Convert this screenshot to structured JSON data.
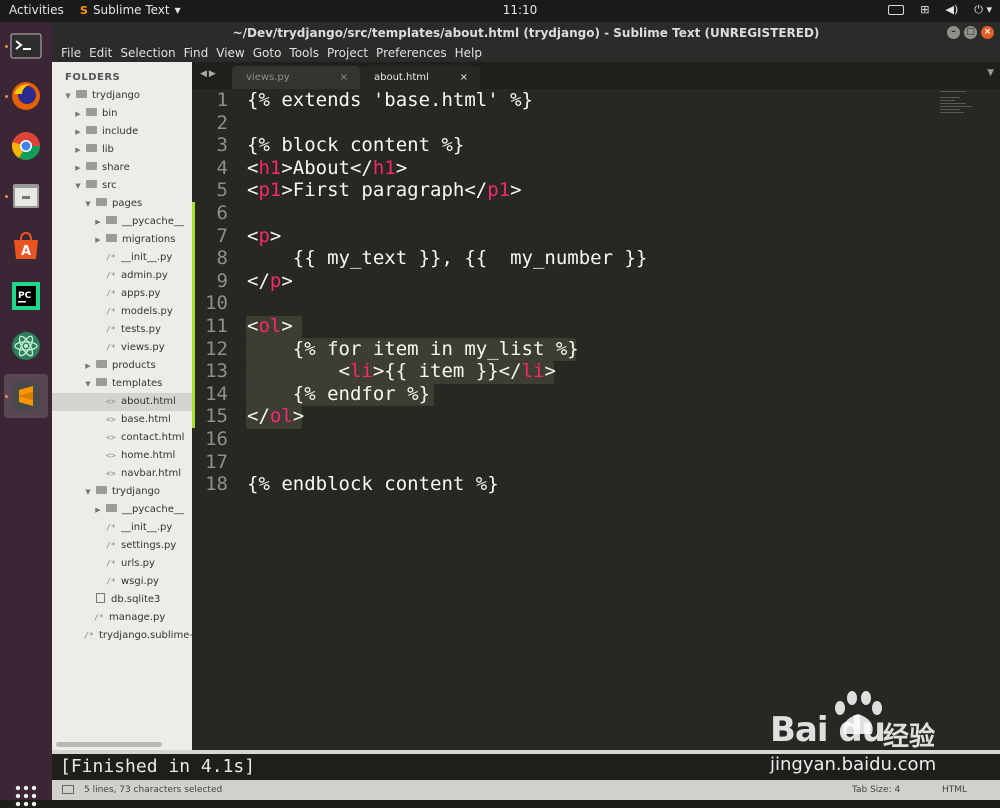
{
  "topbar": {
    "activities": "Activities",
    "app_name": "Sublime Text",
    "clock": "11:10"
  },
  "dock": {
    "items": [
      {
        "name": "terminal",
        "icon": "terminal-icon"
      },
      {
        "name": "firefox",
        "icon": "firefox-icon"
      },
      {
        "name": "chrome",
        "icon": "chrome-icon"
      },
      {
        "name": "files",
        "icon": "files-icon"
      },
      {
        "name": "software",
        "icon": "software-center-icon"
      },
      {
        "name": "pycharm",
        "icon": "pycharm-icon"
      },
      {
        "name": "atom",
        "icon": "atom-icon"
      },
      {
        "name": "sublime",
        "icon": "sublime-text-icon"
      }
    ]
  },
  "window": {
    "title": "~/Dev/trydjango/src/templates/about.html (trydjango) - Sublime Text (UNREGISTERED)"
  },
  "menu": [
    "File",
    "Edit",
    "Selection",
    "Find",
    "View",
    "Goto",
    "Tools",
    "Project",
    "Preferences",
    "Help"
  ],
  "sidebar": {
    "header": "FOLDERS",
    "items": [
      {
        "label": "trydjango",
        "type": "folder",
        "state": "open"
      },
      {
        "label": "bin",
        "type": "folder",
        "state": "closed"
      },
      {
        "label": "include",
        "type": "folder",
        "state": "closed"
      },
      {
        "label": "lib",
        "type": "folder",
        "state": "closed"
      },
      {
        "label": "share",
        "type": "folder",
        "state": "closed"
      },
      {
        "label": "src",
        "type": "folder",
        "state": "open"
      },
      {
        "label": "pages",
        "type": "folder",
        "state": "open"
      },
      {
        "label": "__pycache__",
        "type": "folder",
        "state": "closed"
      },
      {
        "label": "migrations",
        "type": "folder",
        "state": "closed"
      },
      {
        "label": "__init__.py",
        "type": "file",
        "glyph": "/*"
      },
      {
        "label": "admin.py",
        "type": "file",
        "glyph": "/*"
      },
      {
        "label": "apps.py",
        "type": "file",
        "glyph": "/*"
      },
      {
        "label": "models.py",
        "type": "file",
        "glyph": "/*"
      },
      {
        "label": "tests.py",
        "type": "file",
        "glyph": "/*"
      },
      {
        "label": "views.py",
        "type": "file",
        "glyph": "/*"
      },
      {
        "label": "products",
        "type": "folder",
        "state": "closed"
      },
      {
        "label": "templates",
        "type": "folder",
        "state": "open"
      },
      {
        "label": "about.html",
        "type": "file",
        "glyph": "<>",
        "selected": true
      },
      {
        "label": "base.html",
        "type": "file",
        "glyph": "<>"
      },
      {
        "label": "contact.html",
        "type": "file",
        "glyph": "<>"
      },
      {
        "label": "home.html",
        "type": "file",
        "glyph": "<>"
      },
      {
        "label": "navbar.html",
        "type": "file",
        "glyph": "<>"
      },
      {
        "label": "trydjango",
        "type": "folder",
        "state": "open"
      },
      {
        "label": "__pycache__",
        "type": "folder",
        "state": "closed"
      },
      {
        "label": "__init__.py",
        "type": "file",
        "glyph": "/*"
      },
      {
        "label": "settings.py",
        "type": "file",
        "glyph": "/*"
      },
      {
        "label": "urls.py",
        "type": "file",
        "glyph": "/*"
      },
      {
        "label": "wsgi.py",
        "type": "file",
        "glyph": "/*"
      },
      {
        "label": "db.sqlite3",
        "type": "db"
      },
      {
        "label": "manage.py",
        "type": "file",
        "glyph": "/*"
      },
      {
        "label": "trydjango.sublime-",
        "type": "file",
        "glyph": "/*"
      }
    ]
  },
  "tabs": [
    {
      "label": "views.py",
      "close": "×",
      "active": false
    },
    {
      "label": "about.html",
      "close": "×",
      "active": true
    }
  ],
  "editor": {
    "lines": [
      {
        "n": "1",
        "text": "{% extends 'base.html' %}"
      },
      {
        "n": "2",
        "text": ""
      },
      {
        "n": "3",
        "text": "{% block content %}"
      },
      {
        "n": "4",
        "text": "<h1>About</h1>"
      },
      {
        "n": "5",
        "text": "<p1>First paragraph</p1>"
      },
      {
        "n": "6",
        "text": ""
      },
      {
        "n": "7",
        "text": "<p>"
      },
      {
        "n": "8",
        "text": "    {{ my_text }}, {{  my_number }}"
      },
      {
        "n": "9",
        "text": "</p>"
      },
      {
        "n": "10",
        "text": ""
      },
      {
        "n": "11",
        "text": "<ol>"
      },
      {
        "n": "12",
        "text": "    {% for item in my_list %}"
      },
      {
        "n": "13",
        "text": "        <li>{{ item }}</li>"
      },
      {
        "n": "14",
        "text": "    {% endfor %}"
      },
      {
        "n": "15",
        "text": "</ol>"
      },
      {
        "n": "16",
        "text": ""
      },
      {
        "n": "17",
        "text": ""
      },
      {
        "n": "18",
        "text": "{% endblock content %}"
      }
    ]
  },
  "output": "[Finished in 4.1s]",
  "status": {
    "selection": "5 lines, 73 characters selected",
    "tab_size": "Tab Size: 4",
    "syntax": "HTML"
  },
  "watermark": {
    "logo": "Bai  du",
    "cn": "经验",
    "url": "jingyan.baidu.com"
  },
  "colors": {
    "editor_bg": "#272822",
    "tag": "#f92672",
    "text": "#f8f8f2",
    "line_number": "#8f908a",
    "modified_marker": "#a6e22e",
    "selection": "#3e3d32",
    "dock_bg": "#3b2636"
  }
}
